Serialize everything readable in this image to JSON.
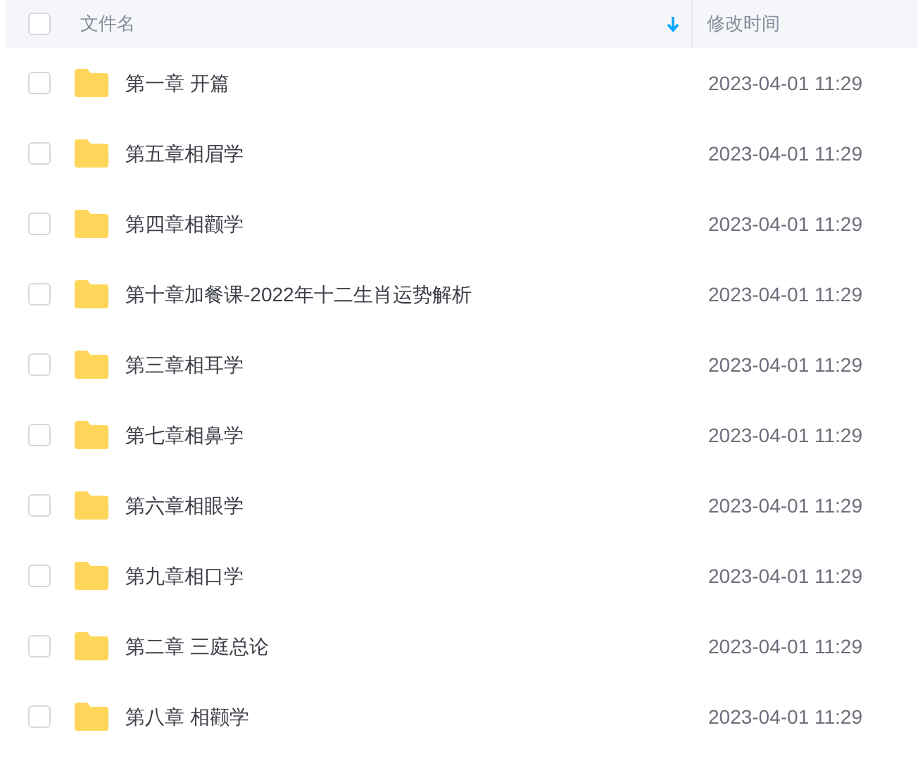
{
  "header": {
    "checked": false,
    "name_label": "文件名",
    "time_label": "修改时间"
  },
  "rows": [
    {
      "name": "第一章 开篇",
      "time": "2023-04-01 11:29",
      "checked": false
    },
    {
      "name": "第五章相眉学",
      "time": "2023-04-01 11:29",
      "checked": false
    },
    {
      "name": "第四章相颧学",
      "time": "2023-04-01 11:29",
      "checked": false
    },
    {
      "name": "第十章加餐课-2022年十二生肖运势解析",
      "time": "2023-04-01 11:29",
      "checked": false
    },
    {
      "name": "第三章相耳学",
      "time": "2023-04-01 11:29",
      "checked": false
    },
    {
      "name": "第七章相鼻学",
      "time": "2023-04-01 11:29",
      "checked": false
    },
    {
      "name": "第六章相眼学",
      "time": "2023-04-01 11:29",
      "checked": false
    },
    {
      "name": "第九章相口学",
      "time": "2023-04-01 11:29",
      "checked": false
    },
    {
      "name": "第二章 三庭总论",
      "time": "2023-04-01 11:29",
      "checked": false
    },
    {
      "name": "第八章 相颧学",
      "time": "2023-04-01 11:29",
      "checked": false
    }
  ]
}
